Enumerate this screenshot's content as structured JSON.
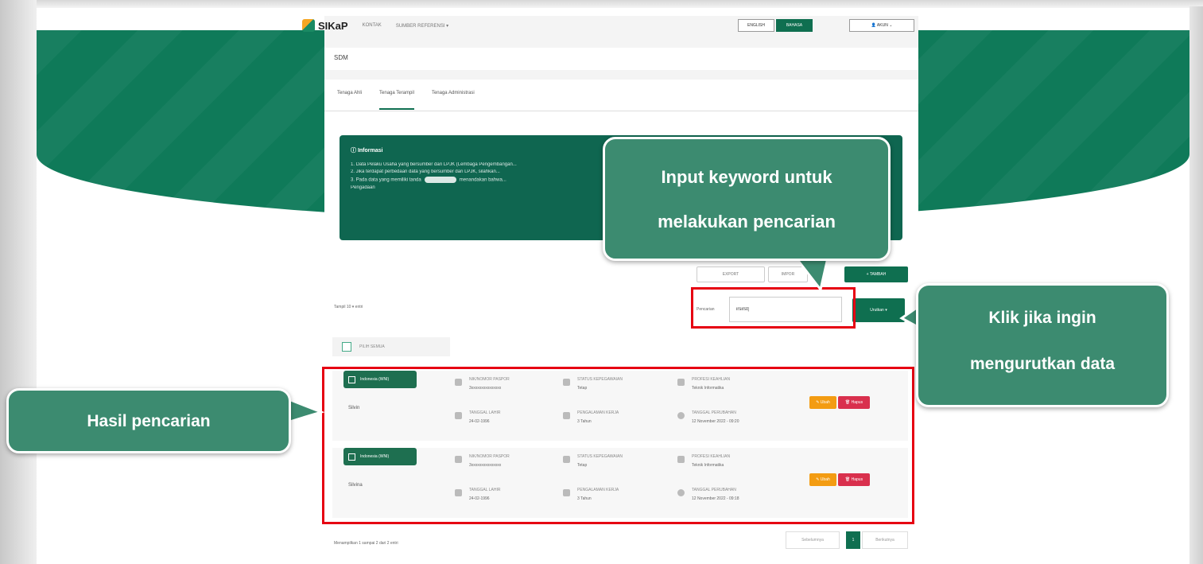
{
  "header": {
    "logo_text": "SIKaP",
    "nav_links": [
      "KONTAK",
      "SUMBER REFERENSI ▾"
    ],
    "lang_english": "ENGLISH",
    "lang_bahasa": "BAHASA",
    "user_menu": "👤 AKUN ⌄"
  },
  "page": {
    "title": "SDM",
    "tabs": [
      "Tenaga Ahli",
      "Tenaga Terampil",
      "Tenaga Administrasi"
    ],
    "active_tab": "Tenaga Terampil"
  },
  "info": {
    "title": "Informasi",
    "lines": [
      "1. Data Pelaku Usaha yang bersumber dari LPJK (Lembaga Pengembangan...",
      "2. Jika terdapat perbedaan data yang bersumber dari LPJK, silahkan...",
      "3. Pada data yang memiliki tanda",
      "Pengadaan"
    ],
    "pill_text": "TERVERIFIKASI",
    "line3_suffix": "menandakan bahwa..."
  },
  "toolbar": {
    "export_label": "EXPORT",
    "other_label": "IMPOR",
    "tambah_label": "+ TAMBAH",
    "show_label": "Tampil  10 ▾  entri",
    "search_label": "Pencarian",
    "search_value": "irsirst|",
    "sort_label": "Urutkan ▾"
  },
  "list": {
    "select_all_label": "PILIH SEMUA",
    "rows": [
      {
        "badge": "Indonesia (WNI)",
        "name": "Silvin",
        "nik_label": "NIK/NOMOR PASPOR",
        "nik": "3xxxxxxxxxxxxxxx",
        "status_label": "STATUS KEPEGAWAIAN",
        "status": "Tetap",
        "edu_label": "PROFESI KEAHLIAN",
        "edu": "Teknik Informatika",
        "dob_label": "TANGGAL LAHIR",
        "dob": "24-02-1996",
        "exp_label": "PENGALAMAN KERJA",
        "exp": "3 Tahun",
        "updated_label": "TANGGAL PERUBAHAN",
        "updated": "12 November 2022 - 09:20",
        "edit_label": "✎ Ubah",
        "delete_label": "🗑 Hapus"
      },
      {
        "badge": "Indonesia (WNI)",
        "name": "Silvina",
        "nik_label": "NIK/NOMOR PASPOR",
        "nik": "3xxxxxxxxxxxxxxx",
        "status_label": "STATUS KEPEGAWAIAN",
        "status": "Tetap",
        "edu_label": "PROFESI KEAHLIAN",
        "edu": "Teknik Informatika",
        "dob_label": "TANGGAL LAHIR",
        "dob": "24-02-1996",
        "exp_label": "PENGALAMAN KERJA",
        "exp": "3 Tahun",
        "updated_label": "TANGGAL PERUBAHAN",
        "updated": "12 November 2022 - 09:18",
        "edit_label": "✎ Ubah",
        "delete_label": "🗑 Hapus"
      }
    ]
  },
  "footer": {
    "summary": "Menampilkan 1 sampai 2 dari 2 entri",
    "prev": "Sebelumnya",
    "page": "1",
    "next": "Berikutnya"
  },
  "annotations": {
    "search_callout_line1": "Input keyword untuk",
    "search_callout_line2": "melakukan pencarian",
    "sort_callout_line1": "Klik jika ingin",
    "sort_callout_line2": "mengurutkan data",
    "results_callout": "Hasil pencarian",
    "callout_color": "#3c8b70",
    "highlight_color": "#e60012"
  }
}
